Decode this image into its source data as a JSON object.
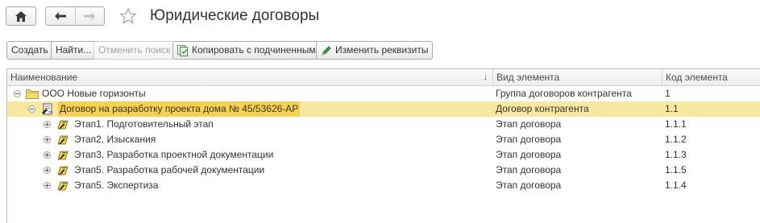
{
  "window": {
    "title": "Юридические договоры"
  },
  "icons": {
    "home": "home-icon",
    "back": "arrow-left-icon",
    "forward": "arrow-right-icon",
    "favorite": "star-icon",
    "copy": "copy-icon",
    "edit": "pencil-icon",
    "folder": "folder-icon",
    "contract": "contract-icon",
    "stage": "stage-icon"
  },
  "toolbar": {
    "create_label": "Создать",
    "find_label": "Найти...",
    "cancel_search_label": "Отменить поиск",
    "copy_with_children_label": "Копировать с подчиненными",
    "change_props_label": "Изменить реквизиты"
  },
  "table": {
    "columns": [
      "Наименование",
      "Вид элемента",
      "Код элемента"
    ],
    "sort_indicator": "↓",
    "rows": [
      {
        "name": "ООО Новые горизонты",
        "kind": "Группа договоров контрагента",
        "code": "1",
        "level": 0,
        "type": "folder",
        "expander": "minus",
        "selected": false
      },
      {
        "name": "Договор на разработку проекта дома № 45/53626-АР",
        "kind": "Договор контрагента",
        "code": "1.1",
        "level": 1,
        "type": "contract",
        "expander": "minus",
        "selected": true
      },
      {
        "name": "Этап1. Подготовительный этап",
        "kind": "Этап договора",
        "code": "1.1.1",
        "level": 2,
        "type": "stage",
        "expander": "plus",
        "selected": false
      },
      {
        "name": "Этап2. Изыскания",
        "kind": "Этап договора",
        "code": "1.1.2",
        "level": 2,
        "type": "stage",
        "expander": "plus",
        "selected": false
      },
      {
        "name": "Этап3. Разработка проектной документации",
        "kind": "Этап договора",
        "code": "1.1.3",
        "level": 2,
        "type": "stage",
        "expander": "plus",
        "selected": false
      },
      {
        "name": "Этап5. Разработка рабочей документации",
        "kind": "Этап договора",
        "code": "1.1.5",
        "level": 2,
        "type": "stage",
        "expander": "plus",
        "selected": false
      },
      {
        "name": "Этап5. Экспертиза",
        "kind": "Этап договора",
        "code": "1.1.4",
        "level": 2,
        "type": "stage",
        "expander": "plus",
        "selected": false
      }
    ]
  },
  "colors": {
    "selected_row": "#f9e8a0",
    "selected_label": "#f7d24e",
    "star": "#b0b0b0"
  }
}
